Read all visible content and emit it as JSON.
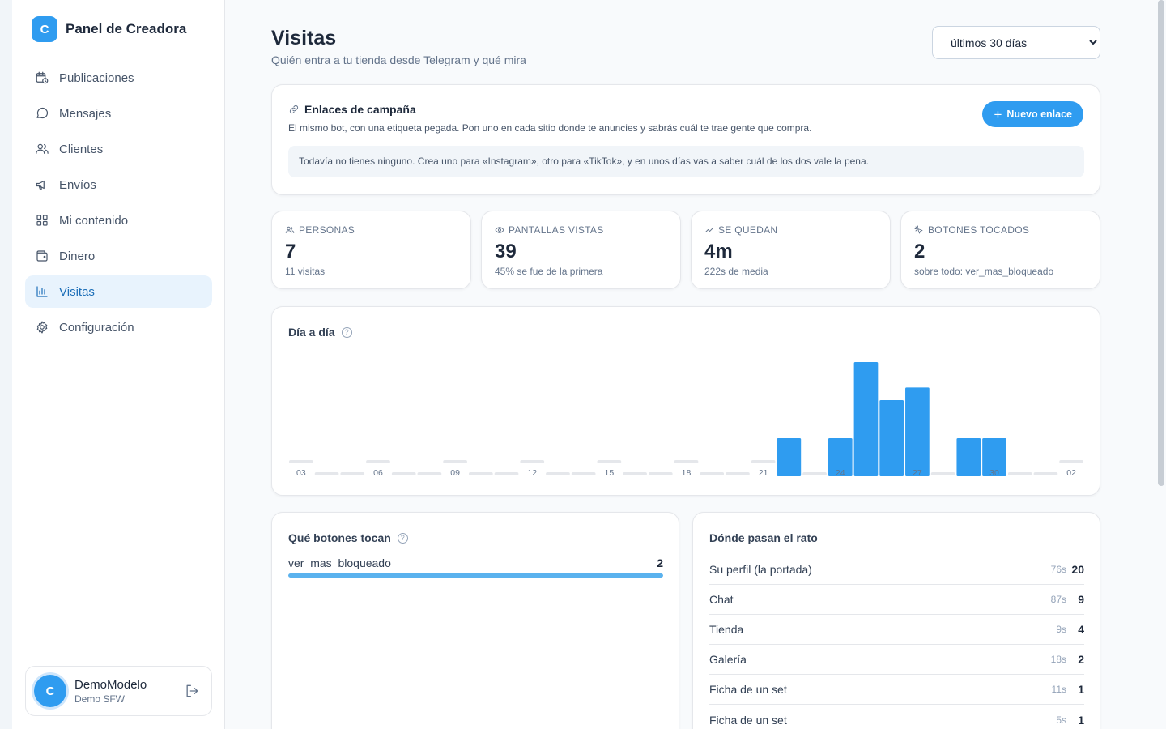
{
  "app": {
    "logo_letter": "C",
    "title": "Panel de Creadora"
  },
  "sidebar": {
    "items": [
      {
        "label": "Publicaciones",
        "icon": "calendar-clock-icon"
      },
      {
        "label": "Mensajes",
        "icon": "chat-bubble-icon"
      },
      {
        "label": "Clientes",
        "icon": "users-icon"
      },
      {
        "label": "Envíos",
        "icon": "megaphone-icon"
      },
      {
        "label": "Mi contenido",
        "icon": "grid-icon"
      },
      {
        "label": "Dinero",
        "icon": "wallet-icon"
      },
      {
        "label": "Visitas",
        "icon": "bar-chart-icon",
        "active": true
      },
      {
        "label": "Configuración",
        "icon": "gear-icon"
      }
    ],
    "user": {
      "avatar_letter": "C",
      "name": "DemoModelo",
      "role": "Demo SFW"
    }
  },
  "header": {
    "title": "Visitas",
    "subtitle": "Quién entra a tu tienda desde Telegram y qué mira",
    "range": {
      "selected": "últimos 30 días"
    }
  },
  "campaign": {
    "title": "Enlaces de campaña",
    "description": "El mismo bot, con una etiqueta pegada. Pon uno en cada sitio donde te anuncies y sabrás cuál te trae gente que compra.",
    "new_button": "Nuevo enlace",
    "empty_text": "Todavía no tienes ninguno. Crea uno para «Instagram», otro para «TikTok», y en unos días vas a saber cuál de los dos vale la pena."
  },
  "stats": [
    {
      "label": "PERSONAS",
      "icon": "users-icon",
      "value": "7",
      "sub": "11 visitas"
    },
    {
      "label": "PANTALLAS VISTAS",
      "icon": "eye-icon",
      "value": "39",
      "sub": "45% se fue de la primera"
    },
    {
      "label": "SE QUEDAN",
      "icon": "trend-up-icon",
      "value": "4m",
      "sub": "222s de media"
    },
    {
      "label": "BOTONES TOCADOS",
      "icon": "tap-icon",
      "value": "2",
      "sub": "sobre todo: ver_mas_bloqueado"
    }
  ],
  "daily": {
    "title": "Día a día",
    "help": "?"
  },
  "chart_data": {
    "type": "bar",
    "title": "Día a día",
    "categories": [
      "03",
      "04",
      "05",
      "06",
      "07",
      "08",
      "09",
      "10",
      "11",
      "12",
      "13",
      "14",
      "15",
      "16",
      "17",
      "18",
      "19",
      "20",
      "21",
      "22",
      "23",
      "24",
      "25",
      "26",
      "27",
      "28",
      "29",
      "30",
      "31",
      "01",
      "02"
    ],
    "values": [
      0,
      0,
      0,
      0,
      0,
      0,
      0,
      0,
      0,
      0,
      0,
      0,
      0,
      0,
      0,
      0,
      0,
      0,
      0,
      3,
      0,
      3,
      9,
      6,
      7,
      0,
      3,
      3,
      0,
      0,
      0
    ],
    "tick_labels": [
      "03",
      "06",
      "09",
      "12",
      "15",
      "18",
      "21",
      "24",
      "27",
      "30",
      "02"
    ],
    "color": "#2f9cf0",
    "grid": false
  },
  "buttons_section": {
    "title": "Qué botones tocan",
    "help": "?",
    "rows": [
      {
        "label": "ver_mas_bloqueado",
        "count": "2",
        "share": 1.0
      }
    ]
  },
  "places_section": {
    "title": "Dónde pasan el rato",
    "rows": [
      {
        "name": "Su perfil (la portada)",
        "time": "76s",
        "count": "20"
      },
      {
        "name": "Chat",
        "time": "87s",
        "count": "9"
      },
      {
        "name": "Tienda",
        "time": "9s",
        "count": "4"
      },
      {
        "name": "Galería",
        "time": "18s",
        "count": "2"
      },
      {
        "name": "Ficha de un set",
        "time": "11s",
        "count": "1"
      },
      {
        "name": "Ficha de un set",
        "time": "5s",
        "count": "1"
      }
    ]
  },
  "colors": {
    "accent": "#2f9cf0",
    "active_bg": "#e8f3fd",
    "bar_track": "#e2e8f0"
  }
}
